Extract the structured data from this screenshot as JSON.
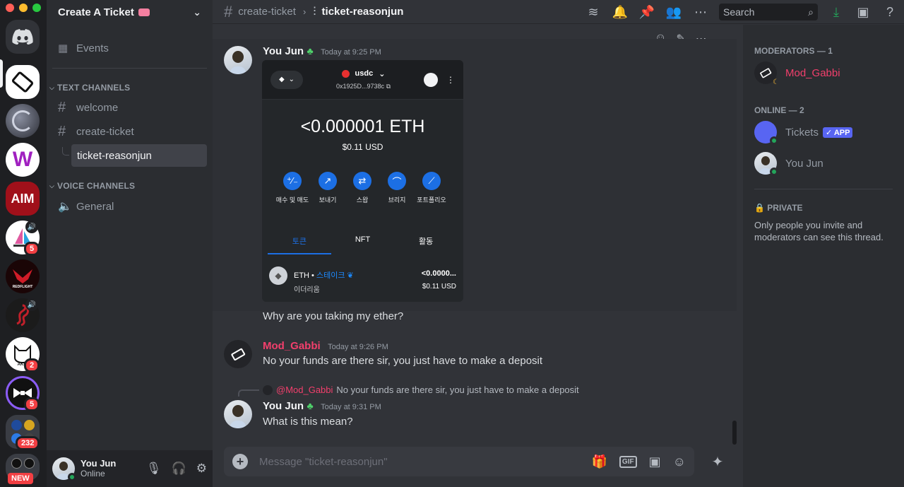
{
  "server": {
    "name": "Create A Ticket",
    "events_label": "Events"
  },
  "rail": {
    "badges": [
      "5",
      "2",
      "5",
      "232"
    ],
    "new_label": "NEW",
    "aim_label": "AIM",
    "redflight_label": "REDFLIGHT",
    "akin_label": "AKIN"
  },
  "sidebar": {
    "text_category": "TEXT CHANNELS",
    "voice_category": "VOICE CHANNELS",
    "channels": [
      "welcome",
      "create-ticket",
      "ticket-reasonjun"
    ],
    "voice_channels": [
      "General"
    ]
  },
  "user_panel": {
    "name": "You Jun",
    "status": "Online"
  },
  "topbar": {
    "channel": "create-ticket",
    "thread": "ticket-reasonjun",
    "search_placeholder": "Search"
  },
  "messages": [
    {
      "author": "You Jun",
      "author_color": "#f2f3f5",
      "time": "Today at 9:25 PM",
      "text": "Why are you taking my ether?"
    },
    {
      "author": "Mod_Gabbi",
      "author_color": "#f23f6c",
      "time": "Today at 9:26 PM",
      "text": "No your funds are there sir, you just have to make a deposit"
    },
    {
      "author": "You Jun",
      "author_color": "#f2f3f5",
      "time": "Today at 9:31 PM",
      "text": "What is this mean?",
      "reply": {
        "mention": "@Mod_Gabbi",
        "text": "No your funds are there sir, you just have to make a deposit"
      }
    }
  ],
  "wallet": {
    "network": "usdc",
    "address": "0x1925D...9738c",
    "balance": "<0.000001 ETH",
    "usd": "$0.11 USD",
    "actions": [
      "매수 및 매도",
      "보내기",
      "스왑",
      "브리지",
      "포트폴리오"
    ],
    "tabs": [
      "토큰",
      "NFT",
      "활동"
    ],
    "token": {
      "symbol": "ETH",
      "stake": "스테이크",
      "name": "이더리움",
      "amount": "<0.0000...",
      "usd": "$0.11 USD"
    }
  },
  "composer": {
    "placeholder": "Message \"ticket-reasonjun\"",
    "gif_label": "GIF"
  },
  "members": {
    "moderators_header": "MODERATORS — 1",
    "online_header": "ONLINE — 2",
    "moderators": [
      "Mod_Gabbi"
    ],
    "online": [
      {
        "name": "Tickets",
        "tag": "APP"
      },
      {
        "name": "You Jun"
      }
    ],
    "private_header": "PRIVATE",
    "private_text": "Only people you invite and moderators can see this thread."
  },
  "colors": {
    "accent": "#5865f2",
    "mod": "#f23f6c",
    "online": "#23a55a",
    "badge": "#f23f43",
    "blue": "#1c6fe4"
  }
}
